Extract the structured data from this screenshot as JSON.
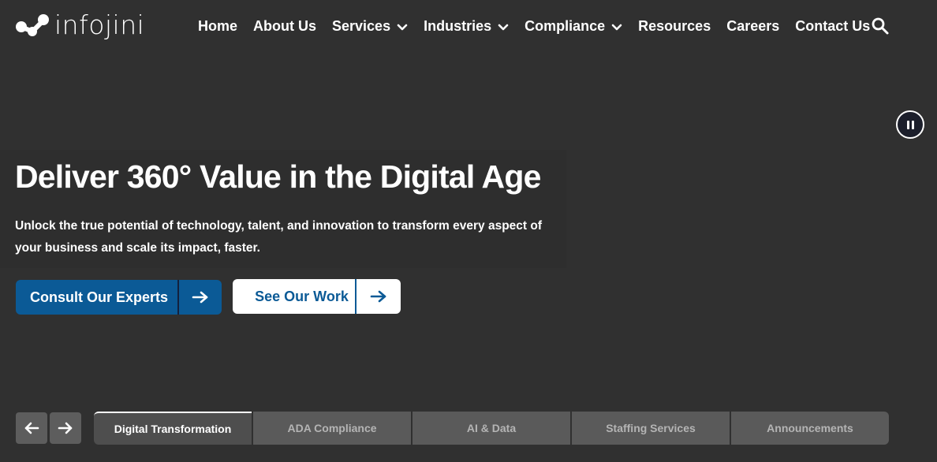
{
  "brand": {
    "name": "infojini"
  },
  "nav": {
    "items": [
      {
        "label": "Home",
        "has_dropdown": false
      },
      {
        "label": "About Us",
        "has_dropdown": false
      },
      {
        "label": "Services",
        "has_dropdown": true
      },
      {
        "label": "Industries",
        "has_dropdown": true
      },
      {
        "label": "Compliance",
        "has_dropdown": true
      },
      {
        "label": "Resources",
        "has_dropdown": false
      },
      {
        "label": "Careers",
        "has_dropdown": false
      },
      {
        "label": "Contact Us",
        "has_dropdown": false
      }
    ],
    "search_icon": "search-icon"
  },
  "hero": {
    "title": "Deliver 360° Value in the Digital Age",
    "subtitle": "Unlock the true potential of technology, talent, and innovation to transform every aspect of your business and scale its impact, faster.",
    "primary_button": {
      "label": "Consult Our Experts",
      "icon": "arrow-right-icon"
    },
    "secondary_button": {
      "label": "See Our Work",
      "icon": "arrow-right-icon"
    }
  },
  "slider": {
    "pause_icon": "pause-icon",
    "prev_icon": "arrow-left-icon",
    "next_icon": "arrow-right-icon",
    "tabs": [
      {
        "label": "Digital Transformation",
        "active": true
      },
      {
        "label": "ADA Compliance",
        "active": false
      },
      {
        "label": "AI & Data",
        "active": false
      },
      {
        "label": "Staffing Services",
        "active": false
      },
      {
        "label": "Announcements",
        "active": false
      }
    ]
  },
  "colors": {
    "background": "#303030",
    "primary_blue": "#0b5a96",
    "white": "#ffffff",
    "tab_bg": "#5a5a5a"
  }
}
